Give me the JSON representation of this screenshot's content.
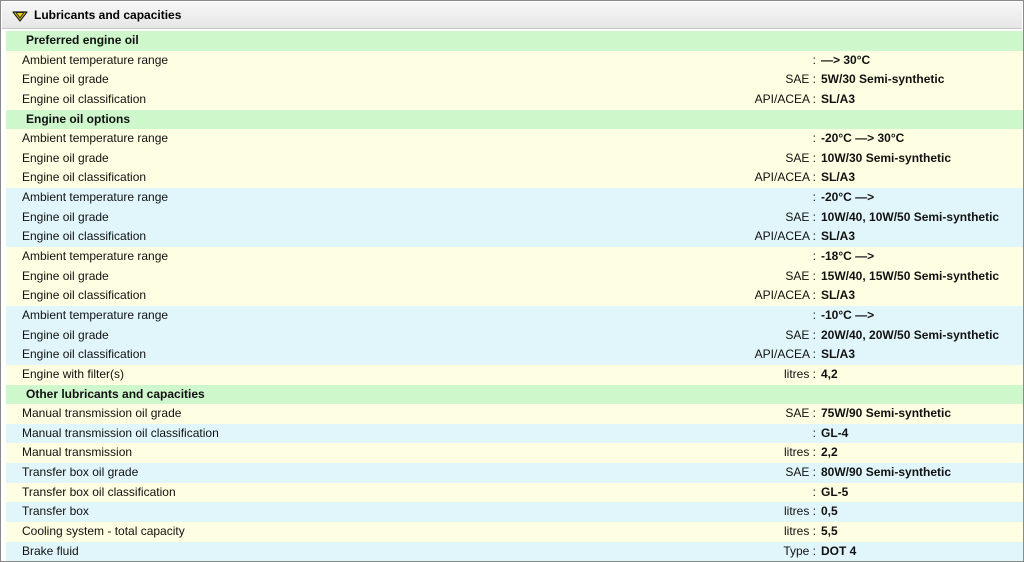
{
  "header": {
    "title": "Lubricants and capacities",
    "icon": "oil-can-icon",
    "icon_color": "#f2d400"
  },
  "colors": {
    "section": "#cef7cc",
    "row_yellow": "#fefee2",
    "row_blue": "#e1f6fb"
  },
  "rows": [
    {
      "type": "section",
      "label": "Preferred engine oil"
    },
    {
      "type": "yellow",
      "label": "Ambient temperature range",
      "unit": ":",
      "value": "—> 30°C"
    },
    {
      "type": "yellow",
      "label": "Engine oil grade",
      "unit": "SAE :",
      "value": "5W/30 Semi-synthetic"
    },
    {
      "type": "yellow",
      "label": "Engine oil classification",
      "unit": "API/ACEA :",
      "value": "SL/A3"
    },
    {
      "type": "section",
      "label": "Engine oil options"
    },
    {
      "type": "yellow",
      "label": "Ambient temperature range",
      "unit": ":",
      "value": "-20°C —> 30°C"
    },
    {
      "type": "yellow",
      "label": "Engine oil grade",
      "unit": "SAE :",
      "value": "10W/30 Semi-synthetic"
    },
    {
      "type": "yellow",
      "label": "Engine oil classification",
      "unit": "API/ACEA :",
      "value": "SL/A3"
    },
    {
      "type": "blue",
      "label": "Ambient temperature range",
      "unit": ":",
      "value": "-20°C —>"
    },
    {
      "type": "blue",
      "label": "Engine oil grade",
      "unit": "SAE :",
      "value": "10W/40, 10W/50 Semi-synthetic"
    },
    {
      "type": "blue",
      "label": "Engine oil classification",
      "unit": "API/ACEA :",
      "value": "SL/A3"
    },
    {
      "type": "yellow",
      "label": "Ambient temperature range",
      "unit": ":",
      "value": "-18°C —>"
    },
    {
      "type": "yellow",
      "label": "Engine oil grade",
      "unit": "SAE :",
      "value": "15W/40, 15W/50 Semi-synthetic"
    },
    {
      "type": "yellow",
      "label": "Engine oil classification",
      "unit": "API/ACEA :",
      "value": "SL/A3"
    },
    {
      "type": "blue",
      "label": "Ambient temperature range",
      "unit": ":",
      "value": "-10°C —>"
    },
    {
      "type": "blue",
      "label": "Engine oil grade",
      "unit": "SAE :",
      "value": "20W/40, 20W/50 Semi-synthetic"
    },
    {
      "type": "blue",
      "label": "Engine oil classification",
      "unit": "API/ACEA :",
      "value": "SL/A3"
    },
    {
      "type": "yellow",
      "label": "Engine with filter(s)",
      "unit": "litres :",
      "value": "4,2"
    },
    {
      "type": "section",
      "label": "Other lubricants and capacities"
    },
    {
      "type": "yellow",
      "label": "Manual transmission oil grade",
      "unit": "SAE :",
      "value": "75W/90 Semi-synthetic"
    },
    {
      "type": "blue",
      "label": "Manual transmission oil classification",
      "unit": ":",
      "value": "GL-4"
    },
    {
      "type": "yellow",
      "label": "Manual transmission",
      "unit": "litres :",
      "value": "2,2"
    },
    {
      "type": "blue",
      "label": "Transfer box oil grade",
      "unit": "SAE :",
      "value": "80W/90 Semi-synthetic"
    },
    {
      "type": "yellow",
      "label": "Transfer box oil classification",
      "unit": ":",
      "value": "GL-5"
    },
    {
      "type": "blue",
      "label": "Transfer box",
      "unit": "litres :",
      "value": "0,5"
    },
    {
      "type": "yellow",
      "label": "Cooling system - total capacity",
      "unit": "litres :",
      "value": "5,5"
    },
    {
      "type": "blue",
      "label": "Brake fluid",
      "unit": "Type :",
      "value": "DOT 4"
    }
  ]
}
